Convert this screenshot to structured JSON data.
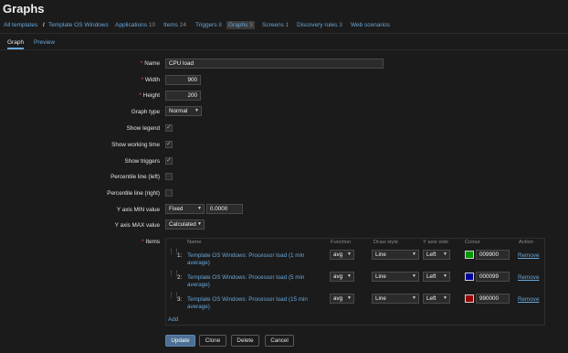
{
  "page_title": "Graphs",
  "nav": {
    "all_templates": "All templates",
    "separator": "/",
    "template": "Template OS Windows",
    "applications": {
      "label": "Applications",
      "count": "10"
    },
    "items": {
      "label": "Items",
      "count": "24"
    },
    "triggers": {
      "label": "Triggers",
      "count": "8"
    },
    "graphs": {
      "label": "Graphs",
      "count": "3"
    },
    "screens": {
      "label": "Screens",
      "count": "1"
    },
    "discovery": {
      "label": "Discovery rules",
      "count": "3"
    },
    "web": {
      "label": "Web scenarios"
    }
  },
  "tabs": {
    "graph": "Graph",
    "preview": "Preview"
  },
  "form": {
    "required_mark": "*",
    "name": {
      "label": "Name",
      "value": "CPU load"
    },
    "width": {
      "label": "Width",
      "value": "900"
    },
    "height": {
      "label": "Height",
      "value": "200"
    },
    "graph_type": {
      "label": "Graph type",
      "value": "Normal"
    },
    "show_legend": {
      "label": "Show legend",
      "checked": true
    },
    "show_working_time": {
      "label": "Show working time",
      "checked": true
    },
    "show_triggers": {
      "label": "Show triggers",
      "checked": true
    },
    "percentile_left": {
      "label": "Percentile line (left)",
      "checked": false
    },
    "percentile_right": {
      "label": "Percentile line (right)",
      "checked": false
    },
    "y_min": {
      "label": "Y axis MIN value",
      "type": "Fixed",
      "value": "0.0000"
    },
    "y_max": {
      "label": "Y axis MAX value",
      "type": "Calculated"
    },
    "items_label": "Items"
  },
  "items_table": {
    "columns": {
      "name": "Name",
      "function": "Function",
      "draw_style": "Draw style",
      "y_axis_side": "Y axis side",
      "colour": "Colour",
      "action": "Action"
    },
    "rows": [
      {
        "num": "1:",
        "name": "Template OS Windows: Processor load (1 min average)",
        "function": "avg",
        "draw_style": "Line",
        "y_axis_side": "Left",
        "colour": "009900",
        "swatch": "#009900",
        "action": "Remove"
      },
      {
        "num": "2:",
        "name": "Template OS Windows: Processor load (5 min average)",
        "function": "avg",
        "draw_style": "Line",
        "y_axis_side": "Left",
        "colour": "000099",
        "swatch": "#000099",
        "action": "Remove"
      },
      {
        "num": "3:",
        "name": "Template OS Windows: Processor load (15 min average)",
        "function": "avg",
        "draw_style": "Line",
        "y_axis_side": "Left",
        "colour": "990000",
        "swatch": "#990000",
        "action": "Remove"
      }
    ],
    "add": "Add"
  },
  "buttons": {
    "update": "Update",
    "clone": "Clone",
    "delete": "Delete",
    "cancel": "Cancel"
  },
  "colors": {
    "link": "#69a7d9",
    "background": "#1b1b1b",
    "primary_button": "#4c6f93",
    "required": "#e45959"
  }
}
